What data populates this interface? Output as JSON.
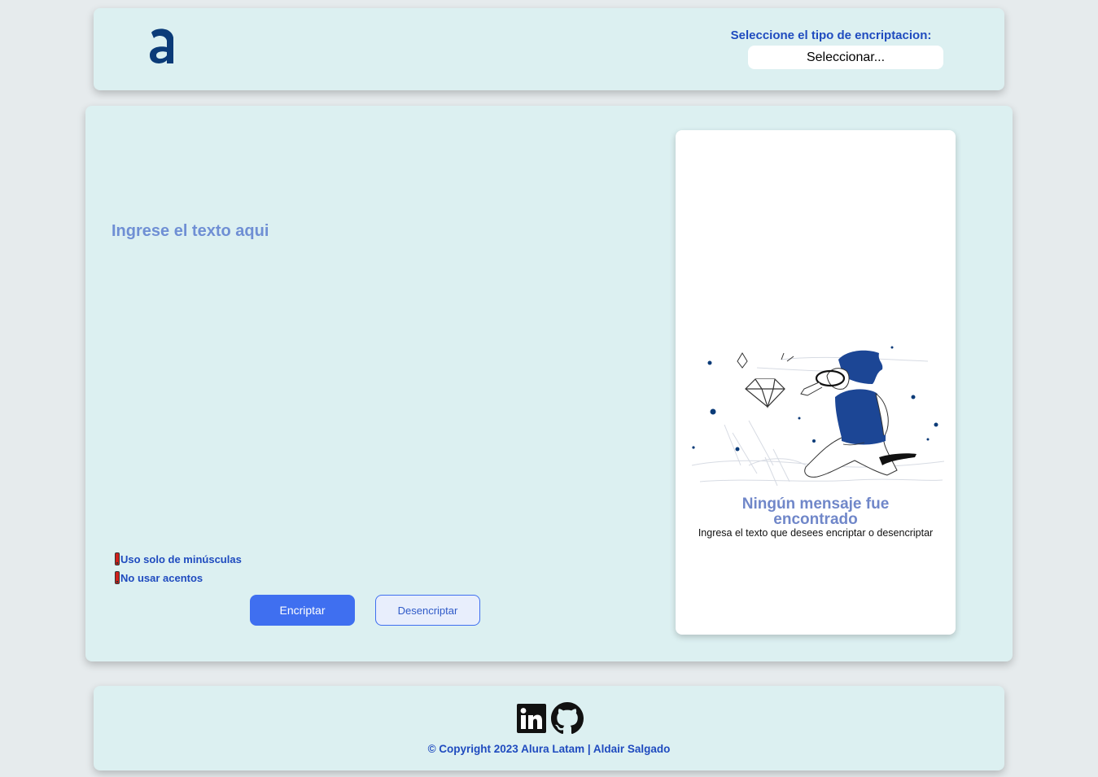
{
  "header": {
    "logo_icon": "alura-a-logo-icon",
    "select_label": "Seleccione el tipo de encriptacion:",
    "select_value": "Seleccionar..."
  },
  "main": {
    "input_placeholder": "Ingrese el texto aqui",
    "hints": [
      "Uso solo de minúsculas",
      "No usar acentos"
    ],
    "hint_icon": "exclamation-warning-icon",
    "encrypt_label": "Encriptar",
    "decrypt_label": "Desencriptar"
  },
  "result": {
    "illustration": "person-searching-magnifier-diamond-illustration",
    "title": "Ningún mensaje fue encontrado",
    "subtitle": "Ingresa el texto que desees encriptar o desencriptar"
  },
  "footer": {
    "icons": [
      "linkedin-icon",
      "github-icon"
    ],
    "copyright": "© Copyright 2023 Alura Latam | Aldair Salgado"
  },
  "colors": {
    "background": "#e6ebed",
    "panel": "#dcf0f1",
    "accent": "#1f4bbf",
    "button": "#3f6ff0",
    "placeholder": "#6f8fd4",
    "title": "#7087c9",
    "logo": "#0b3b78"
  }
}
